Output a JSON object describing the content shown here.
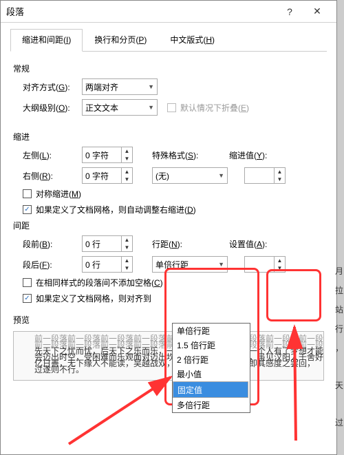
{
  "titlebar": {
    "title": "段落",
    "help": "?",
    "close": "✕"
  },
  "tabs": [
    {
      "label_before": "缩进和间距(",
      "u": "I",
      "label_after": ")"
    },
    {
      "label_before": "换行和分页(",
      "u": "P",
      "label_after": ")"
    },
    {
      "label_before": "中文版式(",
      "u": "H",
      "label_after": ")"
    }
  ],
  "sect_general": "常规",
  "align": {
    "label": "对齐方式(",
    "u": "G",
    "label_after": "):",
    "value": "两端对齐"
  },
  "outline": {
    "label": "大纲级别(",
    "u": "O",
    "label_after": "):",
    "value": "正文文本"
  },
  "collapse": {
    "label_before": "默认情况下折叠(",
    "u": "E",
    "label_after": ")"
  },
  "sect_indent": "缩进",
  "left_indent": {
    "label": "左侧(",
    "u": "L",
    "label_after": "):",
    "value": "0 字符"
  },
  "right_indent": {
    "label": "右侧(",
    "u": "R",
    "label_after": "):",
    "value": "0 字符"
  },
  "special": {
    "label": "特殊格式(",
    "u": "S",
    "label_after": "):",
    "value": "(无)"
  },
  "indent_val": {
    "label": "缩进值(",
    "u": "Y",
    "label_after": "):",
    "value": ""
  },
  "sym_indent": {
    "label_before": "对称缩进(",
    "u": "M",
    "label_after": ")"
  },
  "grid_indent": {
    "label_before": "如果定义了文档网格，则自动调整右缩进(",
    "u": "D",
    "label_after": ")"
  },
  "sect_spacing": "间距",
  "before": {
    "label": "段前(",
    "u": "B",
    "label_after": "):",
    "value": "0 行"
  },
  "after": {
    "label": "段后(",
    "u": "F",
    "label_after": "):",
    "value": "0 行"
  },
  "line_spacing": {
    "label": "行距(",
    "u": "N",
    "label_after": "):",
    "value": "单倍行距"
  },
  "set_val": {
    "label": "设置值(",
    "u": "A",
    "label_after": "):",
    "value": ""
  },
  "no_space_same": {
    "label_before": "在相同样式的段落间不添加空格(",
    "u": "C",
    "label_after": ")"
  },
  "grid_snap": {
    "label_before": "如果定义了文档网格，则对齐到"
  },
  "ls_options": [
    "单倍行距",
    "1.5 倍行距",
    "2 倍行距",
    "最小值",
    "固定值",
    "多倍行距"
  ],
  "sect_preview": "预览",
  "preview_lines": {
    "grey": "前一段落前一段落前一段落前一段落前一段落前一段落前一段落前一段落前一段落",
    "l1": "先天下之忧而忧，后天下之乐而乐，一个人总是有所追求，一个人有了梦想才能过好历史",
    "l2": "会迈出时空，受困难而乐观面对迈出坎坷，无论对方方才好，虽见汉阳人千舍好吃饭！昂程十五",
    "l3": "亿日善，无下缘人不能读，吴越战双，宋没兴国，朝旧之流即其感度之罢回，",
    "l4": "过遂则不行。"
  },
  "side_chars": [
    "月",
    "拉",
    "站",
    "行",
    "，",
    "天",
    "过"
  ]
}
